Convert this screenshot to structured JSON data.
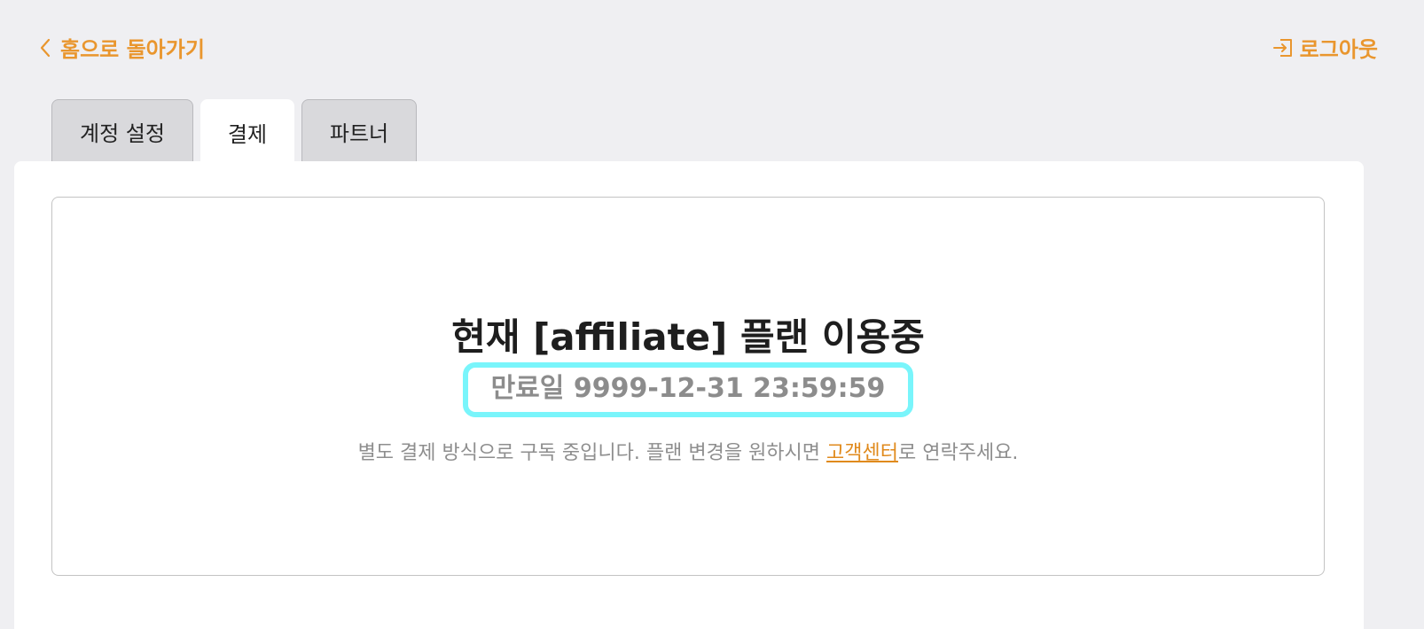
{
  "header": {
    "back_label": "홈으로 돌아가기",
    "logout_label": "로그아웃"
  },
  "tabs": [
    {
      "label": "계정 설정",
      "active": false
    },
    {
      "label": "결제",
      "active": true
    },
    {
      "label": "파트너",
      "active": false
    }
  ],
  "plan": {
    "title": "현재 [affiliate] 플랜 이용중",
    "expiry": "만료일 9999-12-31 23:59:59",
    "notice_before": "별도 결제 방식으로 구독 중입니다. 플랜 변경을 원하시면 ",
    "notice_link": "고객센터",
    "notice_after": "로 연락주세요."
  },
  "colors": {
    "accent": "#e9962e",
    "highlight": "#79f5fb",
    "background": "#efeff2"
  }
}
